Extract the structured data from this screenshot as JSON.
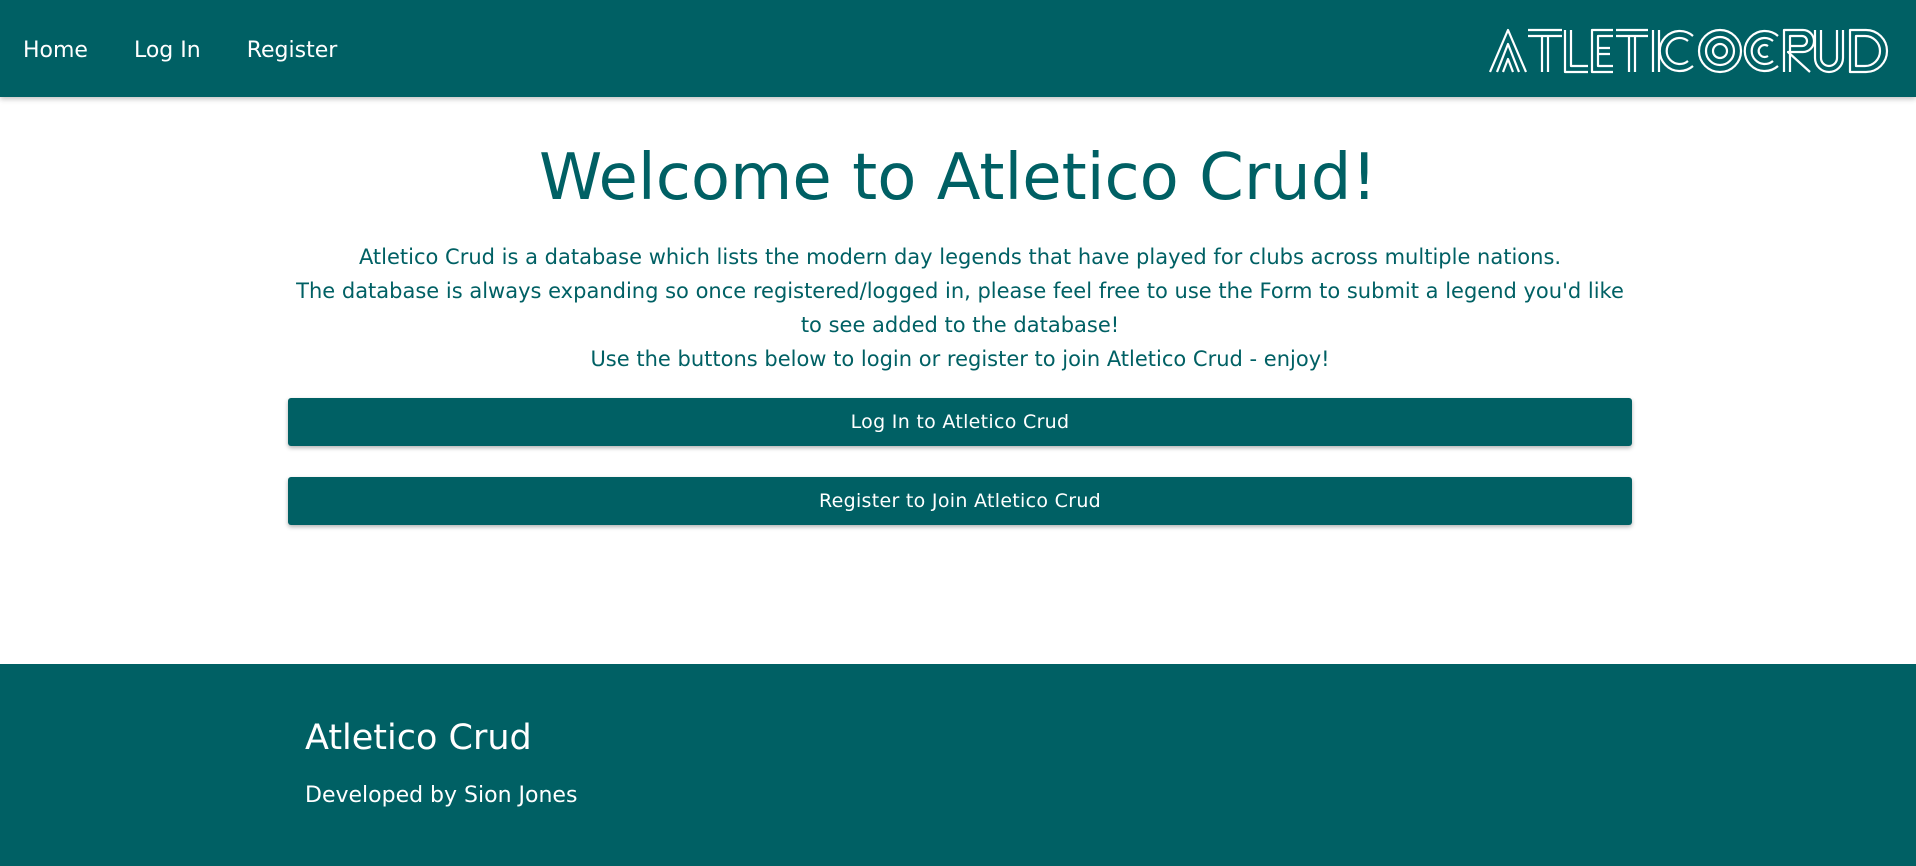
{
  "nav": {
    "links": [
      "Home",
      "Log In",
      "Register"
    ],
    "brand_logo_text": "AtleticoCrud"
  },
  "main": {
    "title": "Welcome to Atletico Crud!",
    "paragraphs": [
      "Atletico Crud is a database which lists the modern day legends that have played for clubs across multiple nations.",
      "The database is always expanding so once registered/logged in, please feel free to use the Form to submit a legend you'd like to see added to the database!",
      "Use the buttons below to login or register to join Atletico Crud - enjoy!"
    ],
    "login_button_label": "Log In to Atletico Crud",
    "register_button_label": "Register to Join Atletico Crud"
  },
  "footer": {
    "title": "Atletico Crud",
    "credit": "Developed by Sion Jones"
  },
  "colors": {
    "primary": "#006064",
    "background": "#ffffff",
    "text_on_primary": "#ffffff"
  }
}
